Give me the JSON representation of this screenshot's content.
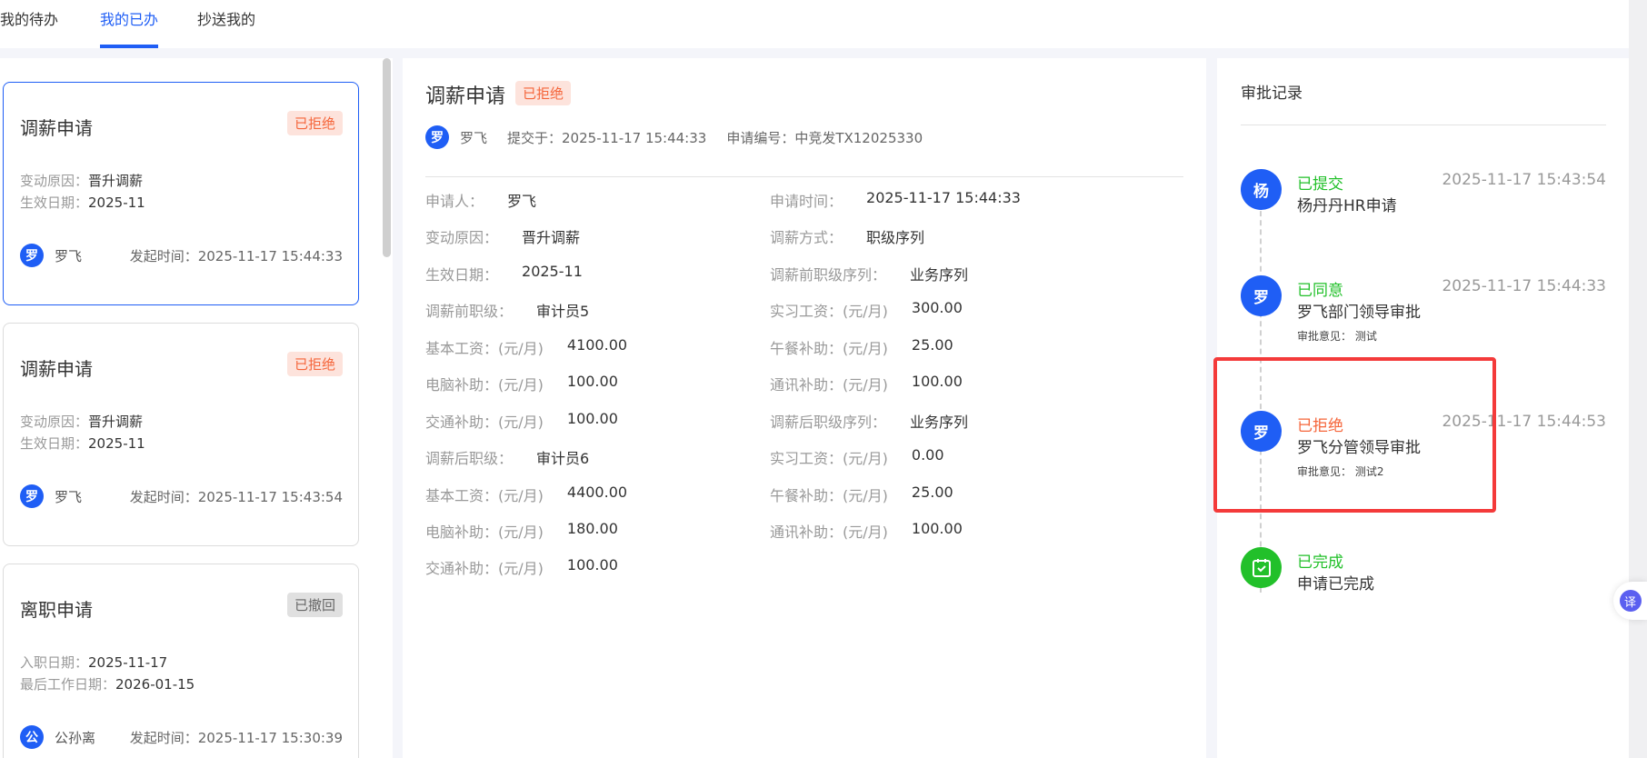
{
  "tabs": [
    "我的待办",
    "我的已办",
    "抄送我的"
  ],
  "cards": [
    {
      "title": "调薪申请",
      "status": "已拒绝",
      "l1": "变动原因：",
      "v1": "晋升调薪",
      "l2": "生效日期：",
      "v2": "2025-11",
      "avatar": "罗",
      "name": "罗飞",
      "time": "发起时间：2025-11-17 15:44:33"
    },
    {
      "title": "调薪申请",
      "status": "已拒绝",
      "l1": "变动原因：",
      "v1": "晋升调薪",
      "l2": "生效日期：",
      "v2": "2025-11",
      "avatar": "罗",
      "name": "罗飞",
      "time": "发起时间：2025-11-17 15:43:54"
    },
    {
      "title": "离职申请",
      "status": "已撤回",
      "l1": "入职日期：",
      "v1": "2025-11-17",
      "l2": "最后工作日期：",
      "v2": "2026-01-15",
      "avatar": "公",
      "name": "公孙离",
      "time": "发起时间：2025-11-17 15:30:39"
    }
  ],
  "detail": {
    "title": "调薪申请",
    "status": "已拒绝",
    "avatar": "罗",
    "name": "罗飞",
    "submitted": "提交于：2025-11-17 15:44:33",
    "number": "申请编号：中竞发TX12025330",
    "left": [
      [
        "申请人：",
        "罗飞"
      ],
      [
        "变动原因：",
        "晋升调薪"
      ],
      [
        "生效日期：",
        "2025-11"
      ],
      [
        "调薪前职级：",
        "审计员5"
      ],
      [
        "基本工资：(元/月)",
        "4100.00"
      ],
      [
        "电脑补助：(元/月)",
        "100.00"
      ],
      [
        "交通补助：(元/月)",
        "100.00"
      ],
      [
        "调薪后职级：",
        "审计员6"
      ],
      [
        "基本工资：(元/月)",
        "4400.00"
      ],
      [
        "电脑补助：(元/月)",
        "180.00"
      ],
      [
        "交通补助：(元/月)",
        "100.00"
      ]
    ],
    "right": [
      [
        "申请时间：",
        "2025-11-17 15:44:33"
      ],
      [
        "调薪方式：",
        "职级序列"
      ],
      [
        "调薪前职级序列：",
        "业务序列"
      ],
      [
        "实习工资：(元/月)",
        "300.00"
      ],
      [
        "午餐补助：(元/月)",
        "25.00"
      ],
      [
        "通讯补助：(元/月)",
        "100.00"
      ],
      [
        "调薪后职级序列：",
        "业务序列"
      ],
      [
        "实习工资：(元/月)",
        "0.00"
      ],
      [
        "午餐补助：(元/月)",
        "25.00"
      ],
      [
        "通讯补助：(元/月)",
        "100.00"
      ]
    ]
  },
  "record": {
    "title": "审批记录",
    "items": [
      {
        "avatar": "杨",
        "status": "已提交",
        "time": "2025-11-17 15:43:54",
        "desc": "杨丹丹HR申请",
        "comment": ""
      },
      {
        "avatar": "罗",
        "status": "已同意",
        "time": "2025-11-17 15:44:33",
        "desc": "罗飞部门领导审批",
        "comment": "审批意见：  测试"
      },
      {
        "avatar": "罗",
        "status": "已拒绝",
        "time": "2025-11-17 15:44:53",
        "desc": "罗飞分管领导审批",
        "comment": "审批意见：  测试2"
      },
      {
        "avatar": "",
        "status": "已完成",
        "time": "",
        "desc": "申请已完成",
        "comment": ""
      }
    ]
  },
  "translate": "译"
}
